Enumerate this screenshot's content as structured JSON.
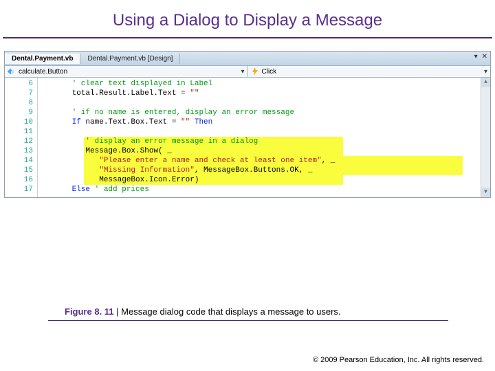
{
  "slide": {
    "title": "Using a Dialog to Display a Message",
    "figure_label": "Figure 8. 11",
    "figure_caption": " | Message dialog code that displays a message to users.",
    "copyright": "© 2009 Pearson Education, Inc.  All rights reserved."
  },
  "ide": {
    "tabs": [
      {
        "label": "Dental.Payment.vb",
        "active": true
      },
      {
        "label": "Dental.Payment.vb [Design]",
        "active": false
      }
    ],
    "class_dropdown": {
      "icon": "field-icon",
      "text": "calculate.Button"
    },
    "method_dropdown": {
      "icon": "bolt-icon",
      "text": "Click"
    },
    "right_icons": {
      "menu": "▾",
      "close": "✕"
    }
  },
  "code": {
    "line_numbers": [
      "6",
      "7",
      "8",
      "9",
      "10",
      "11",
      "12",
      "13",
      "14",
      "15",
      "16",
      "17"
    ],
    "lines": [
      {
        "indent": 2,
        "segments": [
          {
            "t": "' clear text displayed in Label",
            "c": "tok-comment"
          }
        ],
        "hl": false
      },
      {
        "indent": 2,
        "segments": [
          {
            "t": "total.Result.Label.Text = ",
            "c": ""
          },
          {
            "t": "\"\"",
            "c": "tok-string"
          }
        ],
        "hl": false
      },
      {
        "indent": 2,
        "segments": [],
        "hl": false
      },
      {
        "indent": 2,
        "segments": [
          {
            "t": "' if no name is entered, display an error message",
            "c": "tok-comment"
          }
        ],
        "hl": false
      },
      {
        "indent": 2,
        "segments": [
          {
            "t": "If ",
            "c": "tok-keyword"
          },
          {
            "t": "name.Text.Box.Text = ",
            "c": ""
          },
          {
            "t": "\"\"",
            "c": "tok-string"
          },
          {
            "t": " Then",
            "c": "tok-keyword"
          }
        ],
        "hl": false
      },
      {
        "indent": 2,
        "segments": [],
        "hl": false
      },
      {
        "indent": 3,
        "segments": [
          {
            "t": "' display an error message in a dialog",
            "c": "tok-comment"
          }
        ],
        "hl": true,
        "short": true
      },
      {
        "indent": 3,
        "segments": [
          {
            "t": "Message.Box.Show( _",
            "c": ""
          }
        ],
        "hl": true,
        "short": true
      },
      {
        "indent": 4,
        "segments": [
          {
            "t": "\"Please enter a name and check at least one item\"",
            "c": "tok-string"
          },
          {
            "t": ", _",
            "c": ""
          }
        ],
        "hl": true
      },
      {
        "indent": 4,
        "segments": [
          {
            "t": "\"Missing Information\"",
            "c": "tok-string"
          },
          {
            "t": ", MessageBox.Buttons.OK, _",
            "c": ""
          }
        ],
        "hl": true
      },
      {
        "indent": 4,
        "segments": [
          {
            "t": "MessageBox.Icon.Error)",
            "c": ""
          }
        ],
        "hl": true,
        "short": true
      },
      {
        "indent": 2,
        "segments": [
          {
            "t": "Else ",
            "c": "tok-keyword"
          },
          {
            "t": "' add prices",
            "c": "tok-comment"
          }
        ],
        "hl": false
      }
    ]
  }
}
